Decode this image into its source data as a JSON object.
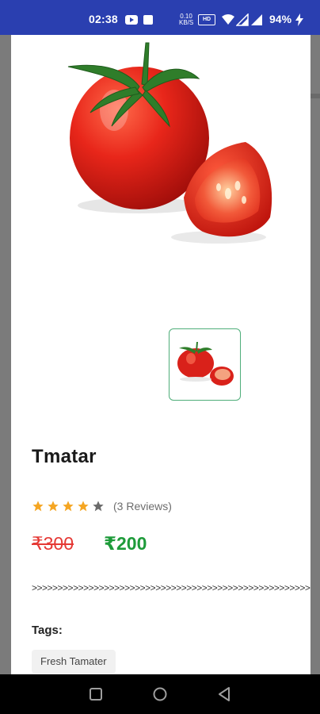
{
  "status_bar": {
    "time": "02:38",
    "network_speed": "0.10 KB/S",
    "hd_label": "HD",
    "battery": "94%"
  },
  "product": {
    "name": "Tmatar",
    "rating": 4,
    "rating_max": 5,
    "reviews": "(3 Reviews)",
    "original_price": "₹300",
    "sale_price": "₹200",
    "divider": ">>>>>>>>>>>>>>>>>>>>>>>>>>>>>>>>>>>>>>>>>>>>>>>>>>>>>>>>>>>>>>>>>>>>",
    "tags_label": "Tags:",
    "tags": [
      "Fresh Tamater"
    ]
  },
  "colors": {
    "status_bar": "#2a3fb0",
    "star_filled": "#f5a623",
    "star_empty": "#6b6b6b",
    "price_old": "#e53935",
    "price_new": "#1e9b3a",
    "thumb_border": "#4fae7a"
  },
  "icons": {
    "status": [
      "youtube-icon",
      "gallery-icon",
      "hd-icon",
      "wifi-icon",
      "signal-icon",
      "signal-icon",
      "charging-icon"
    ],
    "nav": [
      "recents-icon",
      "home-icon",
      "back-icon"
    ]
  }
}
